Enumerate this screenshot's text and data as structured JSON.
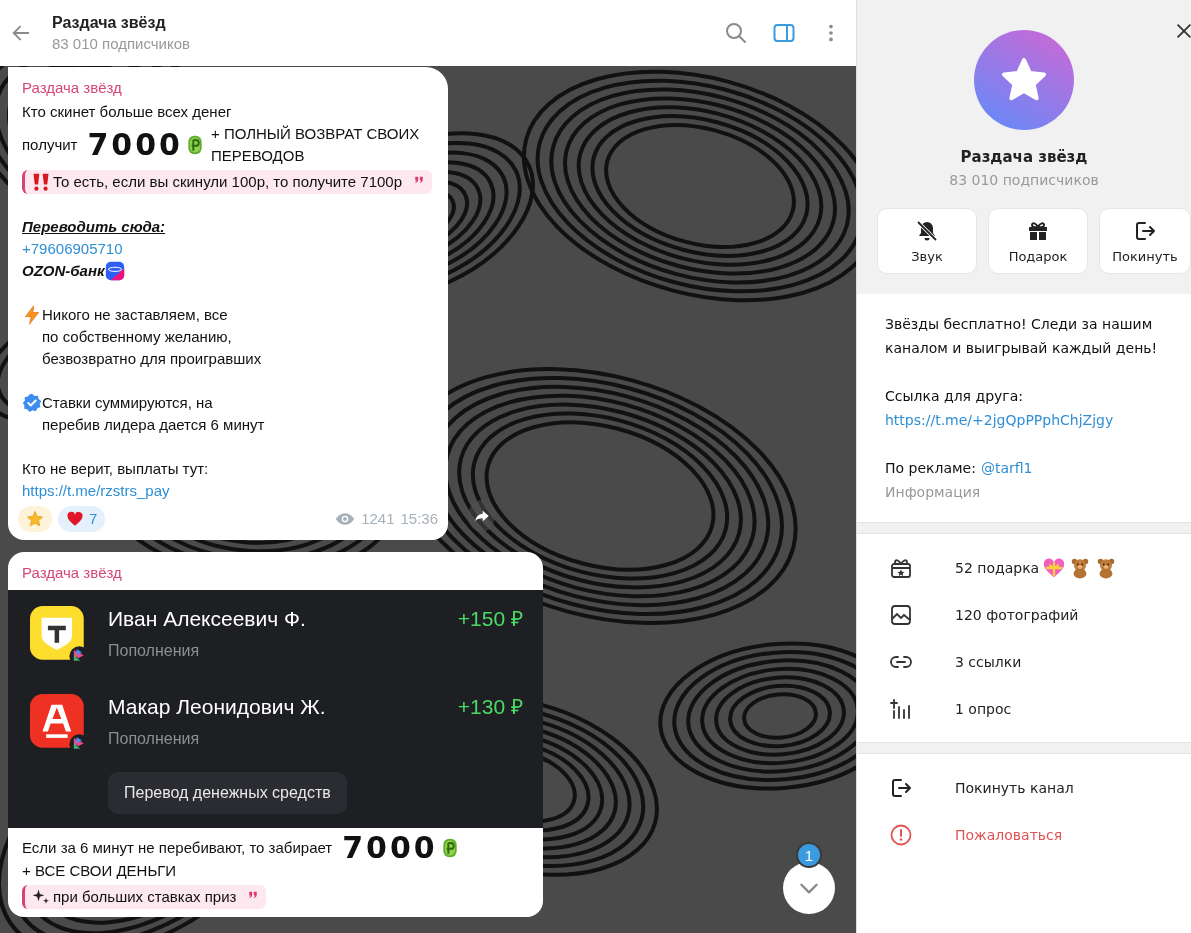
{
  "header": {
    "title": "Раздача звёзд",
    "subtitle": "83 010 подписчиков",
    "sidebar_toggle": {
      "on": true
    }
  },
  "messages": [
    {
      "author": "Раздача звёзд",
      "paragraphs": [
        [
          {
            "kind": "text",
            "text": "Кто скинет больше всех денег"
          },
          {
            "kind": "prize",
            "before": "получит",
            "amount": "7000",
            "after": "+ ПОЛНЫЙ ВОЗВРАТ СВОИХ ПЕРЕВОДОВ"
          },
          {
            "kind": "quote",
            "text": "То есть, если вы скинули 100р, то получите 7100р"
          }
        ],
        [
          {
            "kind": "heading",
            "text": "Переводить сюда:"
          },
          {
            "kind": "link",
            "text": "+79606905710"
          },
          {
            "kind": "bank",
            "text": "OZON-банк"
          }
        ],
        [
          {
            "kind": "bullet",
            "text": "Никого не заставляем, все\nпо собственному желанию,\nбезвозвратно для проигравших"
          }
        ],
        [
          {
            "kind": "bullet",
            "text": "Ставки суммируются, на\nперебив лидера дается 6 минут"
          }
        ],
        [
          {
            "kind": "text",
            "text": "Кто не верит, выплаты тут:"
          },
          {
            "kind": "link",
            "text": "https://t.me/rzstrs_pay"
          }
        ]
      ],
      "reactions": [
        {
          "kind": "star"
        },
        {
          "kind": "heart",
          "count": "7"
        }
      ],
      "views": "1241",
      "time": "15:36"
    },
    {
      "author": "Раздача звёзд",
      "transfer_card": {
        "rows": [
          {
            "name": "Иван Алексеевич Ф.",
            "category": "Пополнения",
            "amount": "+150 ₽"
          },
          {
            "name": "Макар Леонидович Ж.",
            "category": "Пополнения",
            "amount": "+130 ₽"
          }
        ],
        "button": "Перевод денежных средств"
      },
      "paragraphs": [
        [
          {
            "kind": "prize",
            "before": "Если за 6 минут не перебивают, то забирает",
            "amount": "7000",
            "after": "+ ВСЕ СВОИ ДЕНЬГИ"
          },
          {
            "kind": "quote",
            "text": "при больших ставках приз"
          }
        ]
      ]
    }
  ],
  "scroll_button": {
    "badge": "1"
  },
  "profile": {
    "name": "Раздача звёзд",
    "subscribers": "83 010 подписчиков",
    "actions": [
      {
        "label": "Звук"
      },
      {
        "label": "Подарок"
      },
      {
        "label": "Покинуть"
      }
    ],
    "about": {
      "description": "Звёзды бесплатно! Следи за нашим каналом и выигрывай каждый день!",
      "friend_link_label": "Ссылка для друга:",
      "friend_link": "https://t.me/+2jgQpPPphChjZjgy",
      "ads_label": "По рекламе:",
      "ads_handle": "@tarfl1",
      "caption": "Информация"
    },
    "stats": [
      {
        "text": "52 подарка"
      },
      {
        "text": "120 фотографий"
      },
      {
        "text": "3 ссылки"
      },
      {
        "text": "1 опрос"
      }
    ],
    "menu": [
      {
        "label": "Покинуть канал",
        "kind": "normal"
      },
      {
        "label": "Пожаловаться",
        "kind": "danger"
      }
    ]
  }
}
